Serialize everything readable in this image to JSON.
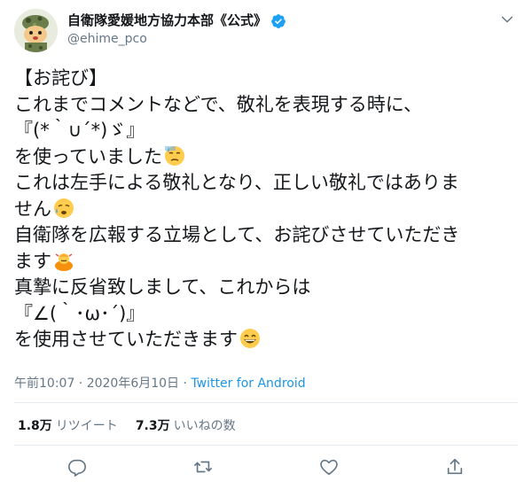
{
  "account": {
    "display_name": "自衛隊愛媛地方協力本部《公式》",
    "handle": "@ehime_pco",
    "verified_icon": "verified-badge-icon"
  },
  "tweet": {
    "lines": [
      "【お詫び】",
      "これまでコメントなどで、敬礼を表現する時に、",
      "『(*｀∪´*)ゞ』",
      "を使っていました",
      "これは左手による敬礼となり、正しい敬礼ではありま",
      "せん",
      "自衛隊を広報する立場として、お詫びさせていただき",
      "ます",
      "真摯に反省致しまして、これからは",
      "『∠(｀･ω･´)』",
      "を使用させていただきます"
    ],
    "emoji": {
      "line4": "downcast-sweat-emoji",
      "line6": "sad-relieved-emoji",
      "line8": "person-bowing-emoji",
      "line11": "grinning-smile-emoji"
    }
  },
  "meta": {
    "time_date": "午前10:07 · 2020年6月10日 · ",
    "source": "Twitter for Android"
  },
  "stats": {
    "retweets_count": "1.8万",
    "retweets_label": "リツイート",
    "likes_count": "7.3万",
    "likes_label": "いいねの数"
  },
  "actions": [
    "reply-icon",
    "retweet-icon",
    "like-icon",
    "share-icon"
  ],
  "colors": {
    "link": "#1b95e0",
    "muted": "#657786",
    "text": "#14171a",
    "divider": "#e6ecf0",
    "verified": "#1da1f2"
  }
}
